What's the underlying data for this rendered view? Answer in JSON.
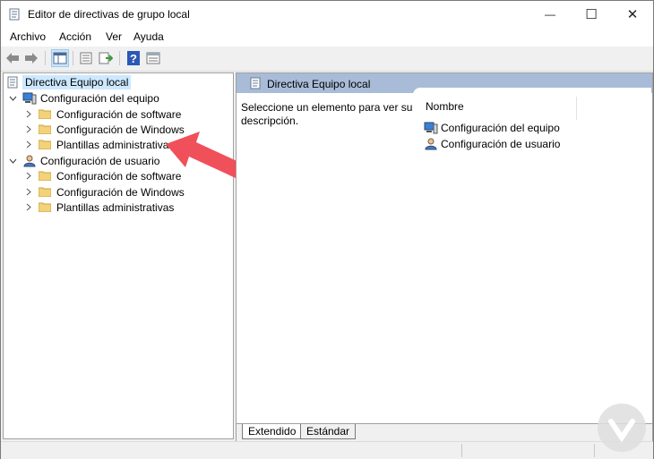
{
  "window": {
    "title": "Editor de directivas de grupo local"
  },
  "window_controls": {
    "minimize": "—",
    "maximize": "☐",
    "close": "✕"
  },
  "menu": [
    {
      "label": "Archivo"
    },
    {
      "label": "Acción"
    },
    {
      "label": "Ver"
    },
    {
      "label": "Ayuda"
    }
  ],
  "toolbar": {
    "buttons": [
      "back-icon",
      "forward-icon",
      "show-hide-tree-icon",
      "properties-icon",
      "export-list-icon",
      "help-icon",
      "details-view-icon"
    ],
    "active": "show-hide-tree-icon"
  },
  "tree": {
    "root": "Directiva Equipo local",
    "equipo": {
      "label": "Configuración del equipo",
      "children": [
        "Configuración de software",
        "Configuración de Windows",
        "Plantillas administrativas"
      ]
    },
    "usuario": {
      "label": "Configuración de usuario",
      "children": [
        "Configuración de software",
        "Configuración de Windows",
        "Plantillas administrativas"
      ]
    }
  },
  "details": {
    "header": "Directiva Equipo local",
    "description": "Seleccione un elemento para ver su descripción.",
    "column": "Nombre",
    "items": [
      "Configuración del equipo",
      "Configuración de usuario"
    ]
  },
  "tabs": [
    "Extendido",
    "Estándar"
  ],
  "colors": {
    "selection": "#cce8ff",
    "header": "#a8bcd8",
    "arrow": "#f0505a",
    "folder": "#f4d27a"
  }
}
